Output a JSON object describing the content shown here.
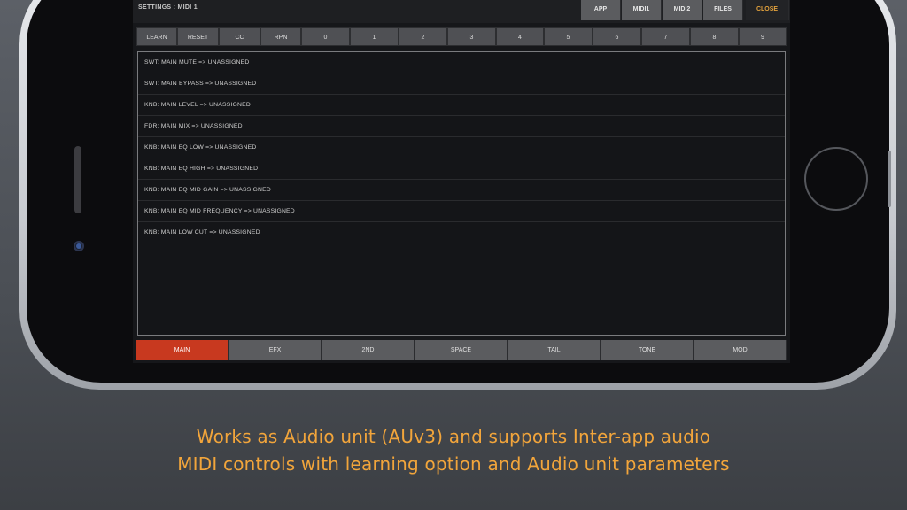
{
  "settings": {
    "title": "SETTINGS : MIDI 1",
    "top_tabs": [
      "APP",
      "MIDI1",
      "MIDI2",
      "FILES",
      "CLOSE"
    ],
    "row_buttons": [
      "LEARN",
      "RESET",
      "CC",
      "RPN",
      "0",
      "1",
      "2",
      "3",
      "4",
      "5",
      "6",
      "7",
      "8",
      "9"
    ],
    "assignments": [
      "SWT: MAIN MUTE => UNASSIGNED",
      "SWT: MAIN BYPASS => UNASSIGNED",
      "KNB: MAIN LEVEL => UNASSIGNED",
      "FDR: MAIN MIX => UNASSIGNED",
      "KNB: MAIN EQ LOW => UNASSIGNED",
      "KNB: MAIN EQ HIGH => UNASSIGNED",
      "KNB: MAIN EQ MID GAIN => UNASSIGNED",
      "KNB: MAIN EQ MID FREQUENCY => UNASSIGNED",
      "KNB: MAIN LOW CUT => UNASSIGNED"
    ],
    "bottom_tabs": [
      "MAIN",
      "EFX",
      "2ND",
      "SPACE",
      "TAIL",
      "TONE",
      "MOD"
    ],
    "active_bottom_tab": "MAIN"
  },
  "caption": {
    "line1": "Works as Audio unit (AUv3) and supports Inter-app audio",
    "line2": "MIDI controls with learning option and Audio unit parameters"
  },
  "colors": {
    "accent": "#e2a13c",
    "active_tab": "#c8391f",
    "caption": "#f2a53b"
  }
}
